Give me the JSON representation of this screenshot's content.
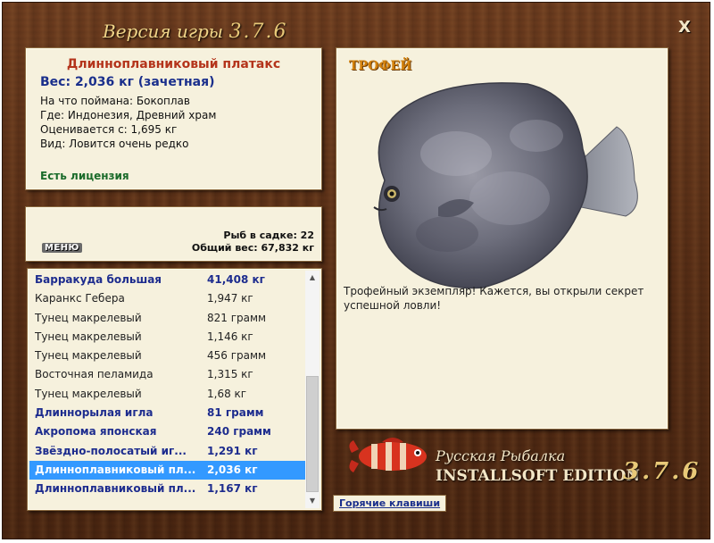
{
  "window": {
    "title_prefix": "Версия игры",
    "title_version": "3.7.6",
    "close": "X"
  },
  "catch": {
    "name": "Длинноплавниковый платакс",
    "weight": "Вес: 2,036 кг (зачетная)",
    "bait": "На что поймана: Бокоплав",
    "location": "Где: Индонезия, Древний храм",
    "valued_from": "Оценивается с: 1,695 кг",
    "rarity": "Вид: Ловится очень редко",
    "license": "Есть лицензия"
  },
  "cage": {
    "menu_label": "МЕНЮ",
    "count": "Рыб в садке: 22",
    "total_weight": "Общий вес: 67,832 кг"
  },
  "fish_list": [
    {
      "name": "Барракуда большая",
      "weight": "41,408 кг",
      "bold": true,
      "selected": false
    },
    {
      "name": "Каранкс Гебера",
      "weight": "1,947 кг",
      "bold": false,
      "selected": false
    },
    {
      "name": "Тунец макрелевый",
      "weight": "821 грамм",
      "bold": false,
      "selected": false
    },
    {
      "name": "Тунец макрелевый",
      "weight": "1,146 кг",
      "bold": false,
      "selected": false
    },
    {
      "name": "Тунец макрелевый",
      "weight": "456 грамм",
      "bold": false,
      "selected": false
    },
    {
      "name": "Восточная пеламида",
      "weight": "1,315 кг",
      "bold": false,
      "selected": false
    },
    {
      "name": "Тунец макрелевый",
      "weight": "1,68 кг",
      "bold": false,
      "selected": false
    },
    {
      "name": "Длиннорылая игла",
      "weight": "81 грамм",
      "bold": true,
      "selected": false
    },
    {
      "name": "Акропома японская",
      "weight": "240 грамм",
      "bold": true,
      "selected": false
    },
    {
      "name": "Звёздно-полосатый иг...",
      "weight": "1,291 кг",
      "bold": true,
      "selected": false
    },
    {
      "name": "Длинноплавниковый пл...",
      "weight": "2,036 кг",
      "bold": true,
      "selected": true
    },
    {
      "name": "Длинноплавниковый пл...",
      "weight": "1,167 кг",
      "bold": true,
      "selected": false
    }
  ],
  "trophy": {
    "label": "ТРОФЕЙ",
    "message": "Трофейный экземпляр! Кажется, вы открыли секрет успешной ловли!"
  },
  "brand": {
    "name": "Русская Рыбалка",
    "edition": "INSTALLSOFT EDITION",
    "version": "3.7.6"
  },
  "hotkeys_label": "Горячие клавиши",
  "colors": {
    "catch_name": "#b4341b",
    "weight_blue": "#1d2c8e",
    "license_green": "#1a6b2a",
    "trophy_orange": "#d4820c",
    "selection": "#3399ff",
    "panel_bg": "#f6f1dd",
    "wood": "#5a2f16"
  }
}
